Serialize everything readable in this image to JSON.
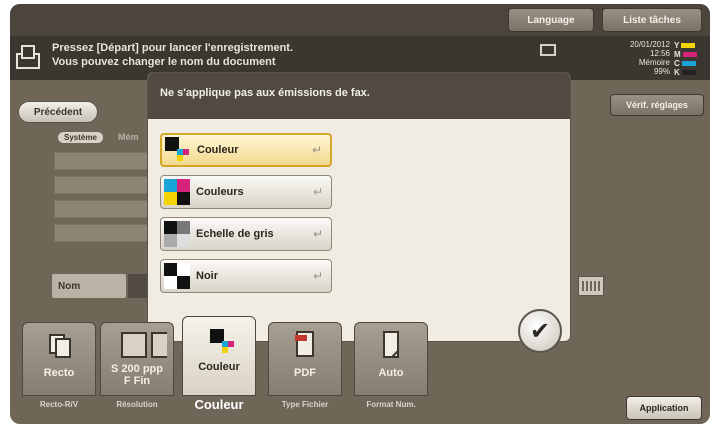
{
  "header": {
    "language_label": "Language",
    "job_list_label": "Liste tâches"
  },
  "message": {
    "line1": "Pressez [Départ] pour lancer l'enregistrement.",
    "line2": "Vous pouvez changer le nom du document"
  },
  "status": {
    "date": "20/01/2012",
    "time": "12:56",
    "memory_label": "Mémoire",
    "memory_value": "99%",
    "toner": [
      {
        "label": "Y",
        "color": "#f4d400"
      },
      {
        "label": "M",
        "color": "#d6247a"
      },
      {
        "label": "C",
        "color": "#1aa5d8"
      },
      {
        "label": "K",
        "color": "#222222"
      }
    ]
  },
  "nav": {
    "previous_label": "Précédent",
    "verify_label": "Vérif. réglages"
  },
  "background_form": {
    "system_tab": "Système",
    "memory_tab": "Mém",
    "name_label": "Nom"
  },
  "dialog": {
    "title": "Ne s'applique pas aux émissions de fax.",
    "options": [
      {
        "label": "Couleur",
        "selected": true
      },
      {
        "label": "Couleurs",
        "selected": false
      },
      {
        "label": "Echelle de gris",
        "selected": false
      },
      {
        "label": "Noir",
        "selected": false
      }
    ],
    "ok_symbol": "✔"
  },
  "bottom_tabs": [
    {
      "value": "Recto",
      "caption": "Recto-R/V"
    },
    {
      "value": "S 200 ppp\nF Fin",
      "caption": "Résolution"
    },
    {
      "value": "Couleur",
      "caption": "Couleur",
      "active": true
    },
    {
      "value": "PDF",
      "caption": "Type Fichier"
    },
    {
      "value": "Auto",
      "caption": "Format Num."
    }
  ],
  "application_label": "Application"
}
